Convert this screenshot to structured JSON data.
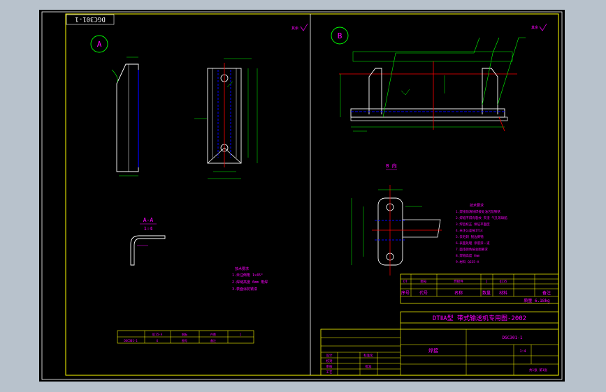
{
  "drawing": {
    "number_rotated": "DGC301-1",
    "view_a": "A",
    "view_b": "B",
    "section_label": "A-A",
    "section_scale": "1:4",
    "view_b_direction": "B 向",
    "roughness_marks": [
      "其余"
    ],
    "left_notes_title": "技术要求",
    "left_notes": [
      "1.未注倒角 1×45°",
      "2.焊缝高度 6mm 角焊",
      "3.表面涂防锈漆"
    ],
    "right_notes_title": "技术要求",
    "right_notes": [
      "1.焊接前清除焊接处油污及铁锈",
      "2.焊缝不得有裂纹 夹渣 气孔等缺陷",
      "3.焊后校正 保证平面度",
      "4.未注公差按IT14",
      "5.去毛刺 锐边倒钝",
      "6.表面处理 涂底漆一道",
      "7.面漆颜色按总图要求",
      "8.焊缝高度 8mm",
      "9.材料 Q235-A"
    ],
    "colors": {
      "background": "#000000",
      "border": "#ffffff",
      "frame": "#ffff00",
      "outline": "#ffffff",
      "dimension": "#00ff00",
      "centerline": "#ff0000",
      "hidden": "#0000ff",
      "text": "#ff00ff",
      "table": "#ffff00"
    }
  },
  "title_block": {
    "project": "DTⅡA型 带式输送机专用图-2002",
    "material_row": [
      "序号",
      "代号",
      "名称",
      "数量",
      "材料",
      "备注"
    ],
    "weight_label": "质量 6.18kg",
    "parts_row": [
      "DT",
      "图号",
      "焊接件",
      "1",
      "Q235",
      ""
    ],
    "drawing_no": "DGC301-1",
    "drawing_name": "焊接",
    "labels": [
      "设计",
      "校对",
      "审核",
      "工艺",
      "标准化",
      "批准"
    ],
    "scale": "1:4",
    "sheet": "共1张 第1张"
  },
  "left_table": {
    "cells": [
      "Q235-A",
      "钢板",
      "件数",
      "1",
      "DGC301-1",
      "6",
      "图号",
      "备注",
      "序号",
      "数量"
    ]
  }
}
